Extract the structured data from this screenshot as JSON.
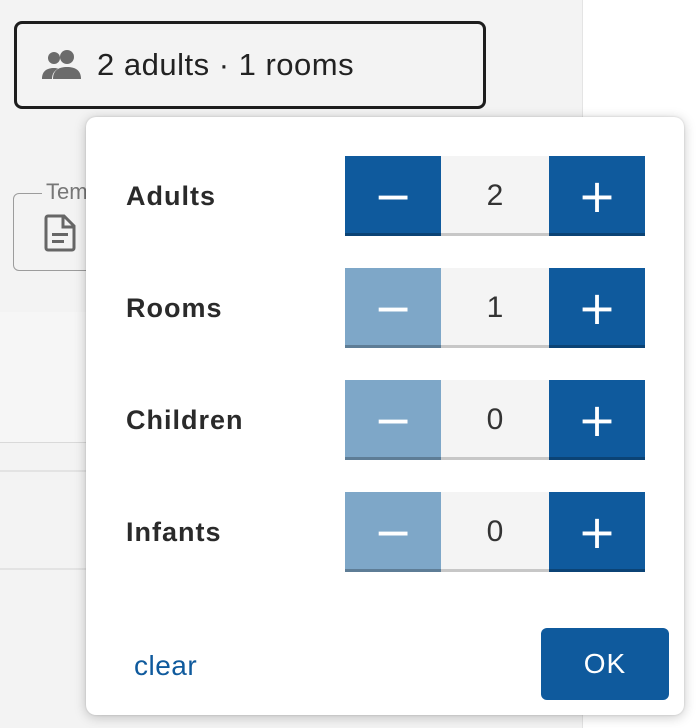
{
  "trigger": {
    "text": "2 adults · 1 rooms",
    "icon": "people-icon"
  },
  "template_field": {
    "legend": "Tem",
    "icon": "document-icon"
  },
  "popover": {
    "rows": [
      {
        "label": "Adults",
        "value": "2",
        "decrement": "−",
        "increment": "+",
        "decrement_enabled": true
      },
      {
        "label": "Rooms",
        "value": "1",
        "decrement": "−",
        "increment": "+",
        "decrement_enabled": false
      },
      {
        "label": "Children",
        "value": "0",
        "decrement": "−",
        "increment": "+",
        "decrement_enabled": false
      },
      {
        "label": "Infants",
        "value": "0",
        "decrement": "−",
        "increment": "+",
        "decrement_enabled": false
      }
    ],
    "clear_label": "clear",
    "ok_label": "OK"
  },
  "colors": {
    "accent": "#0f5a9d",
    "accent_disabled": "#7ea7c8"
  }
}
